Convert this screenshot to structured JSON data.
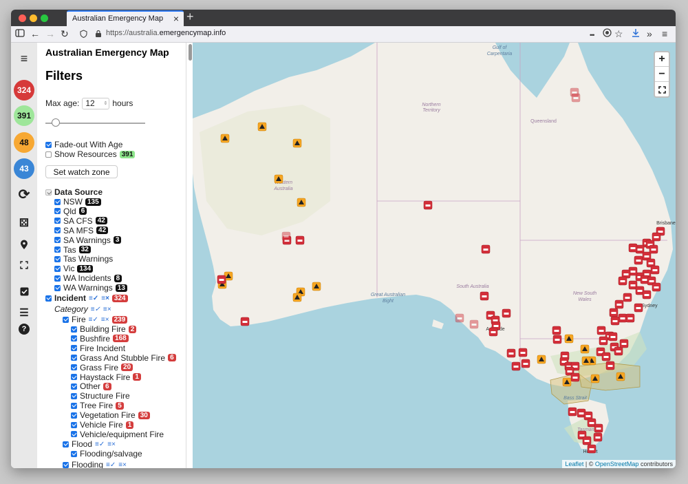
{
  "browser": {
    "tab_title": "Australian Emergency Map",
    "tab_close": "×",
    "new_tab": "+",
    "url_prefix": "https://australia.",
    "url_domain": "emergencymap.info",
    "nav_back": "←",
    "nav_forward": "→",
    "nav_reload": "↻",
    "menu_dots": "•••",
    "overflow": "»",
    "hamburger": "≡"
  },
  "sidebar_icons": {
    "toggle": "≡",
    "incidents_count": "324",
    "resources_count": "391",
    "warnings_count": "48",
    "info_count": "43",
    "refresh": "⟳",
    "dice": "⚄",
    "location": "●",
    "fullscreen": "⛶",
    "checklist": "☑",
    "list": "☰",
    "help": "?"
  },
  "panel": {
    "app_title": "Australian Emergency Map",
    "filters_heading": "Filters",
    "max_age_label": "Max age:",
    "max_age_value": "12",
    "max_age_unit": "hours",
    "max_age_slider_fraction": 0.1,
    "fade_label": "Fade-out With Age",
    "show_resources_label": "Show Resources",
    "show_resources_count": "391",
    "watch_zone_button": "Set watch zone",
    "data_source_label": "Data Source",
    "sources": [
      {
        "label": "NSW",
        "count": "135"
      },
      {
        "label": "Qld",
        "count": "6"
      },
      {
        "label": "SA CFS",
        "count": "42"
      },
      {
        "label": "SA MFS",
        "count": "42"
      },
      {
        "label": "SA Warnings",
        "count": "3"
      },
      {
        "label": "Tas",
        "count": "32"
      },
      {
        "label": "Tas Warnings",
        "count": ""
      },
      {
        "label": "Vic",
        "count": "134"
      },
      {
        "label": "WA Incidents",
        "count": "8"
      },
      {
        "label": "WA Warnings",
        "count": "13"
      }
    ],
    "incident_label": "Incident",
    "incident_count": "324",
    "category_label": "Category",
    "fire_label": "Fire",
    "fire_count": "239",
    "fire_types": [
      {
        "label": "Building Fire",
        "count": "2"
      },
      {
        "label": "Bushfire",
        "count": "168"
      },
      {
        "label": "Fire Incident",
        "count": ""
      },
      {
        "label": "Grass And Stubble Fire",
        "count": "6"
      },
      {
        "label": "Grass Fire",
        "count": "20"
      },
      {
        "label": "Haystack Fire",
        "count": "1"
      },
      {
        "label": "Other",
        "count": "6"
      },
      {
        "label": "Structure Fire",
        "count": ""
      },
      {
        "label": "Tree Fire",
        "count": "5"
      },
      {
        "label": "Vegetation Fire",
        "count": "30"
      },
      {
        "label": "Vehicle Fire",
        "count": "1"
      },
      {
        "label": "Vehicle/equipment Fire",
        "count": ""
      }
    ],
    "flood_label": "Flood",
    "flood_sub": "Flooding/salvage",
    "flooding_label": "Flooding",
    "select_all_glyph": "≡✓",
    "clear_glyph": "≡×"
  },
  "map": {
    "zoom_in": "+",
    "zoom_out": "−",
    "fullscreen": "⛶",
    "attribution_leaflet": "Leaflet",
    "attribution_sep": "| ©",
    "attribution_osm": "OpenStreetMap",
    "attribution_tail": "contributors",
    "labels": {
      "gulf": "Gulf of",
      "gulf2": "Carpentaria",
      "nt": "Northern",
      "nt2": "Territory",
      "qld": "Queensland",
      "wa": "Western",
      "wa2": "Australia",
      "sa": "South Australia",
      "gab": "Great Australian",
      "gab2": "Bight",
      "nsw": "New South",
      "nsw2": "Wales",
      "brisbane": "Brisbane",
      "sydney": "Sydney",
      "bass": "Bass Strait",
      "tas": "Tasmania",
      "hobart": "Hobart",
      "adelaide": "Adelaide"
    }
  }
}
